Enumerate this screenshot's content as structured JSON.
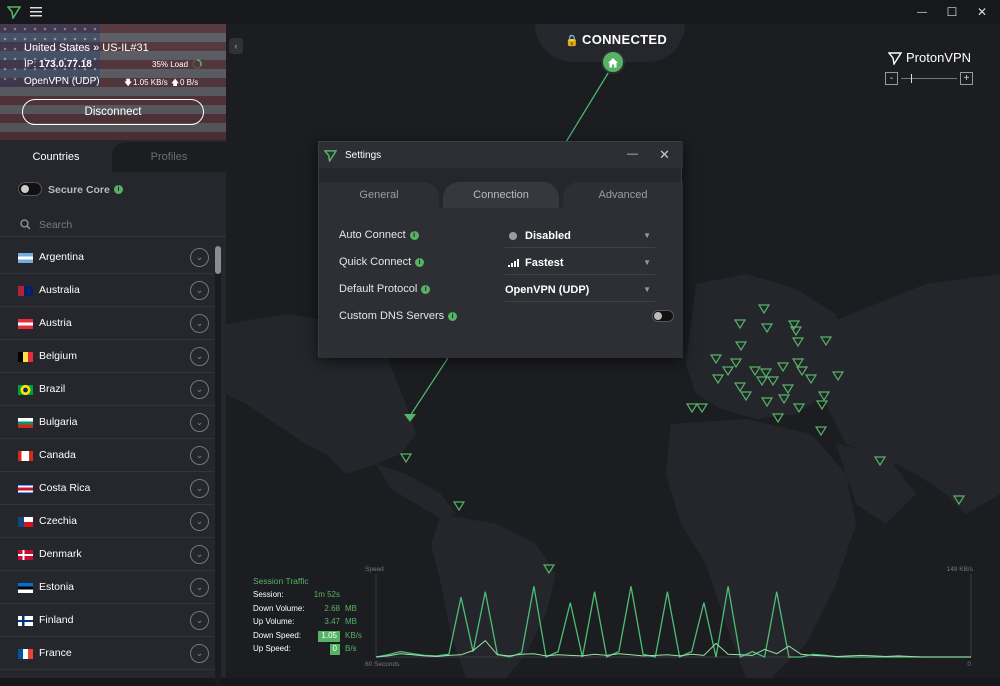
{
  "window": {
    "minimize": "—",
    "maximize": "☐",
    "close": "✕"
  },
  "connection": {
    "server": "United States » US-IL#31",
    "ip_label": "IP:",
    "ip": "173.0.77.18",
    "load": "35% Load",
    "protocol": "OpenVPN (UDP)",
    "down_rate": "1.05 KB/s",
    "up_rate": "0 B/s",
    "disconnect_label": "Disconnect"
  },
  "sidebar": {
    "tabs": [
      "Countries",
      "Profiles"
    ],
    "secure_core_label": "Secure Core",
    "search_placeholder": "Search",
    "countries": [
      "Argentina",
      "Australia",
      "Austria",
      "Belgium",
      "Brazil",
      "Bulgaria",
      "Canada",
      "Costa Rica",
      "Czechia",
      "Denmark",
      "Estonia",
      "Finland",
      "France"
    ]
  },
  "map": {
    "status": "CONNECTED",
    "brand": "ProtonVPN",
    "zoom_minus": "-",
    "zoom_plus": "+"
  },
  "settings": {
    "title": "Settings",
    "tabs": [
      "General",
      "Connection",
      "Advanced"
    ],
    "active_tab": "Connection",
    "rows": [
      {
        "label": "Auto Connect",
        "value": "Disabled"
      },
      {
        "label": "Quick Connect",
        "value": "Fastest"
      },
      {
        "label": "Default Protocol",
        "value": "OpenVPN (UDP)"
      },
      {
        "label": "Custom DNS Servers",
        "value": ""
      }
    ]
  },
  "traffic": {
    "title": "Session Traffic",
    "session_label": "Session:",
    "session": "1m 52s",
    "down_volume_label": "Down Volume:",
    "down_volume": "2.68",
    "down_volume_unit": "MB",
    "up_volume_label": "Up Volume:",
    "up_volume": "3.47",
    "up_volume_unit": "MB",
    "down_speed_label": "Down Speed:",
    "down_speed": "1.05",
    "down_speed_unit": "KB/s",
    "up_speed_label": "Up Speed:",
    "up_speed": "0",
    "up_speed_unit": "B/s"
  },
  "chart_data": {
    "type": "line",
    "ylabel": "Speed",
    "ymax_label": "149 KB/s",
    "xstart_label": "60 Seconds",
    "xend_label": "0",
    "ylim": [
      0,
      149
    ],
    "series": [
      {
        "values": [
          0,
          4,
          10,
          6,
          3,
          2,
          5,
          110,
          10,
          120,
          5,
          0,
          8,
          130,
          0,
          10,
          100,
          0,
          120,
          0,
          10,
          130,
          5,
          0,
          120,
          0,
          10,
          100,
          0,
          130,
          0,
          10,
          0,
          120,
          0,
          0,
          5,
          3,
          0,
          0,
          0,
          0,
          0,
          0,
          0,
          0,
          0,
          0,
          0,
          0
        ]
      },
      {
        "values": [
          0,
          2,
          6,
          4,
          2,
          1,
          3,
          4,
          12,
          30,
          4,
          2,
          5,
          6,
          2,
          4,
          3,
          2,
          5,
          3,
          6,
          4,
          2,
          3,
          4,
          2,
          5,
          3,
          25,
          5,
          4,
          3,
          14,
          6,
          20,
          5,
          3,
          2,
          1,
          2,
          3,
          2,
          1,
          2,
          1,
          0,
          0,
          0,
          0,
          0
        ]
      }
    ],
    "colors": [
      "#4dbd74",
      "#9adfa8"
    ]
  }
}
